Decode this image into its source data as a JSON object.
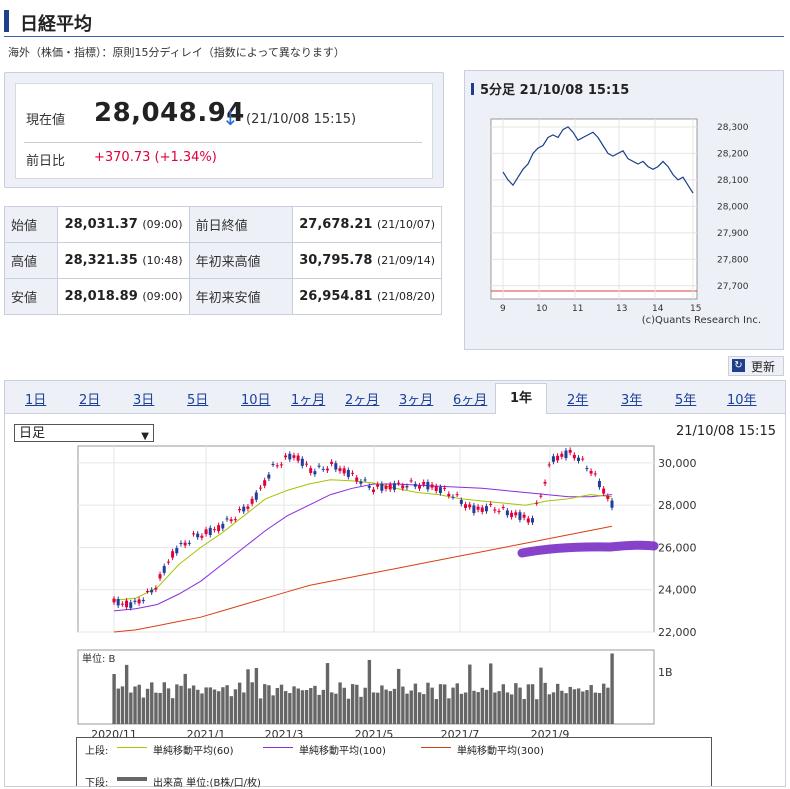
{
  "header": {
    "title": "日経平均"
  },
  "note": "海外（株価・指標）：原則15分ディレイ（指数によって異なります）",
  "current": {
    "label": "現在値",
    "price": "28,048.94",
    "arrow": "↓",
    "datetime": "(21/10/08 15:15)"
  },
  "change": {
    "label": "前日比",
    "value": "+370.73 (+1.34%)"
  },
  "stats": [
    {
      "l1": "始値",
      "v1": "28,031.37",
      "t1": "(09:00)",
      "l2": "前日終値",
      "v2": "27,678.21",
      "t2": "(21/10/07)"
    },
    {
      "l1": "高値",
      "v1": "28,321.35",
      "t1": "(10:48)",
      "l2": "年初来高値",
      "v2": "30,795.78",
      "t2": "(21/09/14)"
    },
    {
      "l1": "安値",
      "v1": "28,018.89",
      "t1": "(09:00)",
      "l2": "年初来安値",
      "v2": "26,954.81",
      "t2": "(21/08/20)"
    }
  ],
  "intraday": {
    "title": "5分足 21/10/08 15:15",
    "credit": "(c)Quants Research Inc.",
    "y_ticks": [
      "28,300",
      "28,200",
      "28,100",
      "28,000",
      "27,900",
      "27,800",
      "27,700"
    ],
    "x_ticks": [
      "9",
      "10",
      "11",
      "13",
      "14",
      "15"
    ]
  },
  "refresh_label": "更新",
  "tabs": [
    "1日",
    "2日",
    "3日",
    "5日",
    "10日",
    "1ヶ月",
    "2ヶ月",
    "3ヶ月",
    "6ヶ月",
    "1年",
    "2年",
    "3年",
    "5年",
    "10年"
  ],
  "active_tab": "1年",
  "period_select": "日足",
  "chart_date": "21/10/08 15:15",
  "main_chart": {
    "y_ticks": [
      "30,000",
      "28,000",
      "26,000",
      "24,000",
      "22,000"
    ],
    "x_ticks": [
      "2020/11",
      "2021/1",
      "2021/3",
      "2021/5",
      "2021/7",
      "2021/9"
    ],
    "volume_unit": "単位: B",
    "volume_tick": "1B"
  },
  "legend": {
    "upper": "上段:",
    "ma60": "単純移動平均(60)",
    "ma100": "単純移動平均(100)",
    "ma300": "単純移動平均(300)",
    "lower": "下段:",
    "vol": "出来高 単位:(B株/口/枚)"
  },
  "colors": {
    "up": "#e0003c",
    "down": "#1f3f9a",
    "ma60": "#a8c400",
    "ma100": "#8a2be2",
    "ma300": "#d94010",
    "intraday": "#1a3f8a"
  },
  "chart_data": [
    {
      "type": "line",
      "x": [
        "9",
        "10",
        "11",
        "13",
        "14",
        "15"
      ],
      "ylim": [
        27650,
        28330
      ],
      "series": [
        {
          "values": [
            28130,
            28100,
            28080,
            28110,
            28140,
            28160,
            28200,
            28220,
            28230,
            28260,
            28270,
            28260,
            28290,
            28300,
            28280,
            28250,
            28260,
            28270,
            28280,
            28260,
            28230,
            28200,
            28190,
            28200,
            28210,
            28180,
            28170,
            28160,
            28170,
            28150,
            28140,
            28150,
            28170,
            28150,
            28120,
            28100,
            28110,
            28080,
            28050
          ]
        }
      ]
    },
    {
      "type": "line",
      "x": [
        "2020/11",
        "2021/1",
        "2021/3",
        "2021/5",
        "2021/7",
        "2021/9"
      ],
      "ylim": [
        22000,
        30800
      ],
      "series": [
        {
          "name": "単純移動平均(60)",
          "values": [
            23500,
            23600,
            24100,
            25200,
            26000,
            26700,
            27500,
            28300,
            28700,
            29000,
            29200,
            29150,
            29050,
            28800,
            28600,
            28500,
            28300,
            28200,
            28100,
            28000,
            28200,
            28300,
            28500,
            28400
          ]
        },
        {
          "name": "単純移動平均(100)",
          "values": [
            23000,
            23100,
            23300,
            23800,
            24400,
            25200,
            26000,
            26800,
            27500,
            28000,
            28500,
            28800,
            29000,
            29000,
            28950,
            28900,
            28850,
            28800,
            28700,
            28600,
            28500,
            28400,
            28400,
            28500
          ]
        },
        {
          "name": "単純移動平均(300)",
          "values": [
            22000,
            22100,
            22300,
            22500,
            22700,
            23000,
            23300,
            23600,
            23900,
            24200,
            24400,
            24600,
            24800,
            25000,
            25200,
            25400,
            25600,
            25800,
            26000,
            26200,
            26400,
            26600,
            26800,
            27000
          ]
        },
        {
          "name": "日経平均",
          "values": [
            23400,
            23300,
            24000,
            25800,
            26500,
            26800,
            27400,
            28200,
            29800,
            30400,
            29600,
            29900,
            29400,
            28800,
            28900,
            29000,
            28900,
            28500,
            27800,
            27900,
            27600,
            27300,
            30200,
            30500,
            29600,
            28048
          ]
        }
      ]
    }
  ]
}
